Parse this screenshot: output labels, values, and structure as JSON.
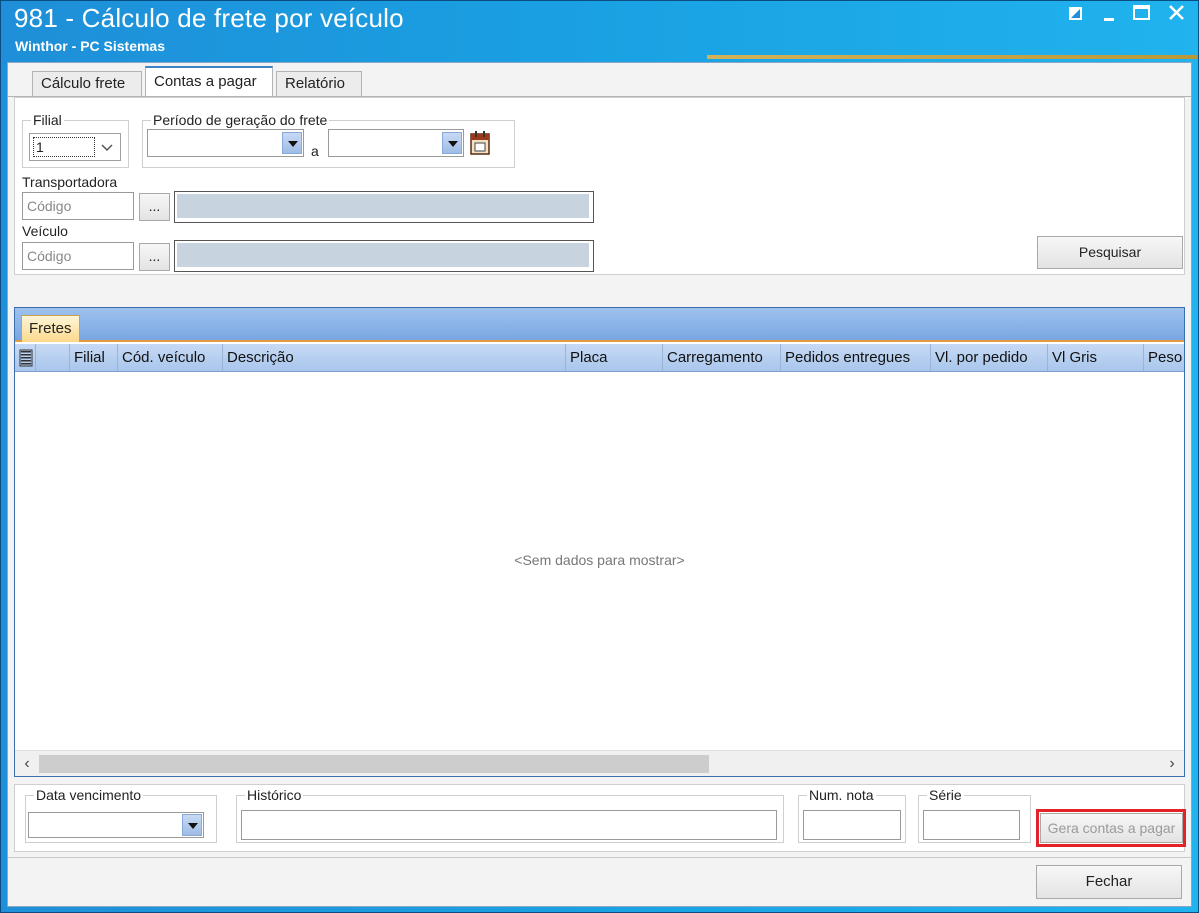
{
  "window": {
    "title": "981 - Cálculo de frete por veículo",
    "subtitle": "Winthor - PC Sistemas"
  },
  "tabs": [
    {
      "label": "Cálculo frete",
      "active": false
    },
    {
      "label": "Contas a pagar",
      "active": true
    },
    {
      "label": "Relatório",
      "active": false
    }
  ],
  "filters": {
    "filial": {
      "label": "Filial",
      "value": "1"
    },
    "periodo": {
      "label": "Período de geração do frete",
      "separator": "a",
      "start": "",
      "end": ""
    },
    "transportadora": {
      "label": "Transportadora",
      "code_placeholder": "Código",
      "lookup_label": "...",
      "description": ""
    },
    "veiculo": {
      "label": "Veículo",
      "code_placeholder": "Código",
      "lookup_label": "...",
      "description": ""
    },
    "search_button": "Pesquisar"
  },
  "grid": {
    "tab_label": "Fretes",
    "columns": [
      "Filial",
      "Cód. veículo",
      "Descrição",
      "Placa",
      "Carregamento",
      "Pedidos entregues",
      "Vl. por pedido",
      "Vl Gris",
      "Peso"
    ],
    "empty_message": "<Sem dados para mostrar>",
    "rows": []
  },
  "payment": {
    "due_date": {
      "label": "Data vencimento",
      "value": ""
    },
    "historico": {
      "label": "Histórico",
      "value": ""
    },
    "num_nota": {
      "label": "Num. nota",
      "value": ""
    },
    "serie": {
      "label": "Série",
      "value": ""
    },
    "generate_button": "Gera contas a pagar"
  },
  "footer": {
    "close_button": "Fechar"
  },
  "colors": {
    "title_bar": "#1aa1e3",
    "grid_header": "#a9c6ec",
    "highlight": "#e3232a"
  }
}
